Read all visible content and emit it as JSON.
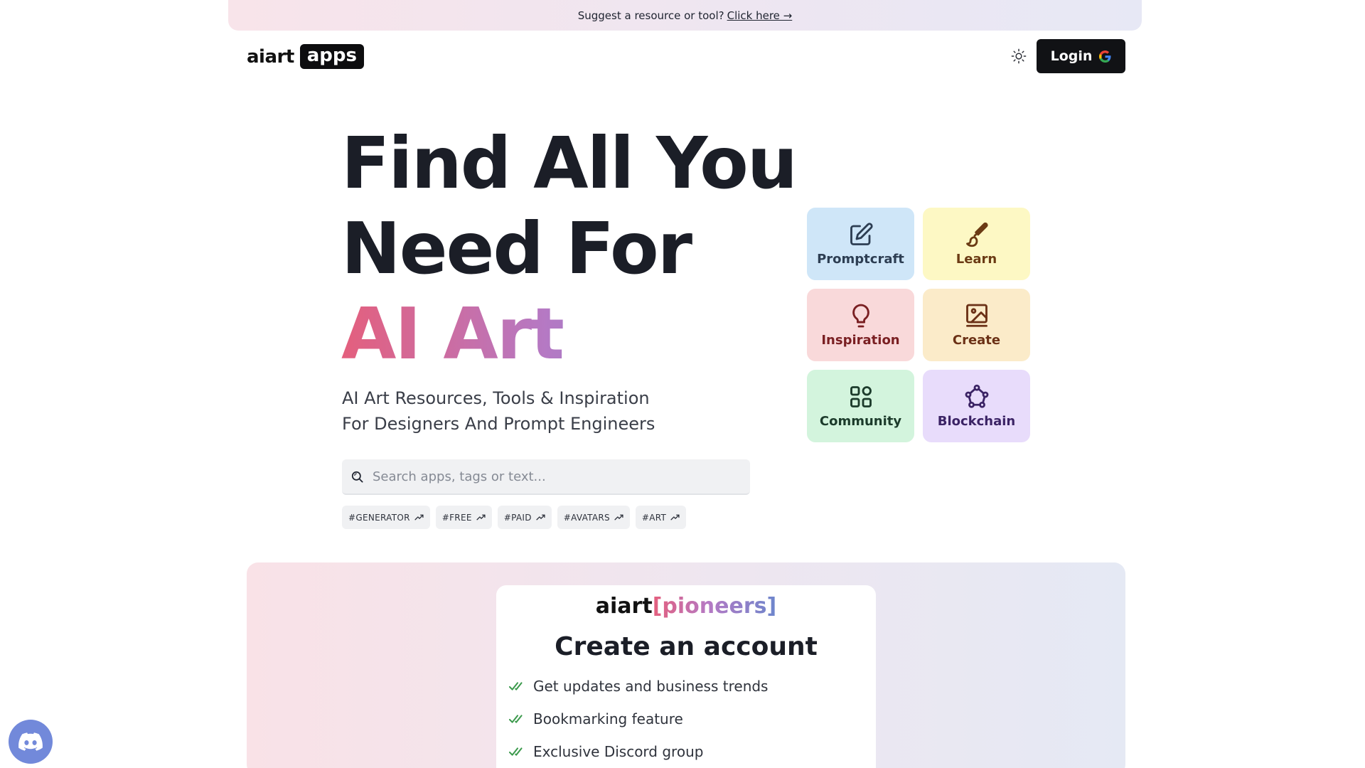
{
  "banner": {
    "text": "Suggest a resource or tool?",
    "link": "Click here →"
  },
  "header": {
    "logo_text": "aiart",
    "logo_badge": "apps",
    "theme_icon": "sun-icon",
    "login_label": "Login"
  },
  "hero": {
    "title_line1": "Find All You",
    "title_line2": "Need For",
    "title_line3": "AI Art",
    "subtitle_line1": "AI Art Resources, Tools & Inspiration",
    "subtitle_line2": "For Designers And Prompt Engineers"
  },
  "search": {
    "placeholder": "Search apps, tags or text...",
    "icon": "search-icon"
  },
  "tags": [
    "#GENERATOR",
    "#FREE",
    "#PAID",
    "#AVATARS",
    "#ART"
  ],
  "categories": [
    {
      "label": "Promptcraft",
      "icon": "edit-icon",
      "bg": "#cfe6f8",
      "color": "#2d3e53"
    },
    {
      "label": "Learn",
      "icon": "brush-icon",
      "bg": "#fdf8c4",
      "color": "#6b3b14"
    },
    {
      "label": "Inspiration",
      "icon": "lightbulb-icon",
      "bg": "#f9d9da",
      "color": "#7a1f22"
    },
    {
      "label": "Create",
      "icon": "image-icon",
      "bg": "#fbebc9",
      "color": "#6b3116"
    },
    {
      "label": "Community",
      "icon": "grid-icon",
      "bg": "#d3f4dd",
      "color": "#1c3b2b"
    },
    {
      "label": "Blockchain",
      "icon": "network-icon",
      "bg": "#e8dcfb",
      "color": "#3b2365"
    }
  ],
  "pioneers": {
    "logo_text": "aiart",
    "logo_bracket": "[pioneers]",
    "title": "Create an account",
    "features": [
      "Get updates and business trends",
      "Bookmarking feature",
      "Exclusive Discord group"
    ]
  },
  "colors": {
    "accent_pink": "#e45f7d",
    "accent_purple": "#b579c4",
    "accent_blue": "#6d86cc",
    "check_green": "#3c9a4d",
    "discord": "#7289da"
  }
}
